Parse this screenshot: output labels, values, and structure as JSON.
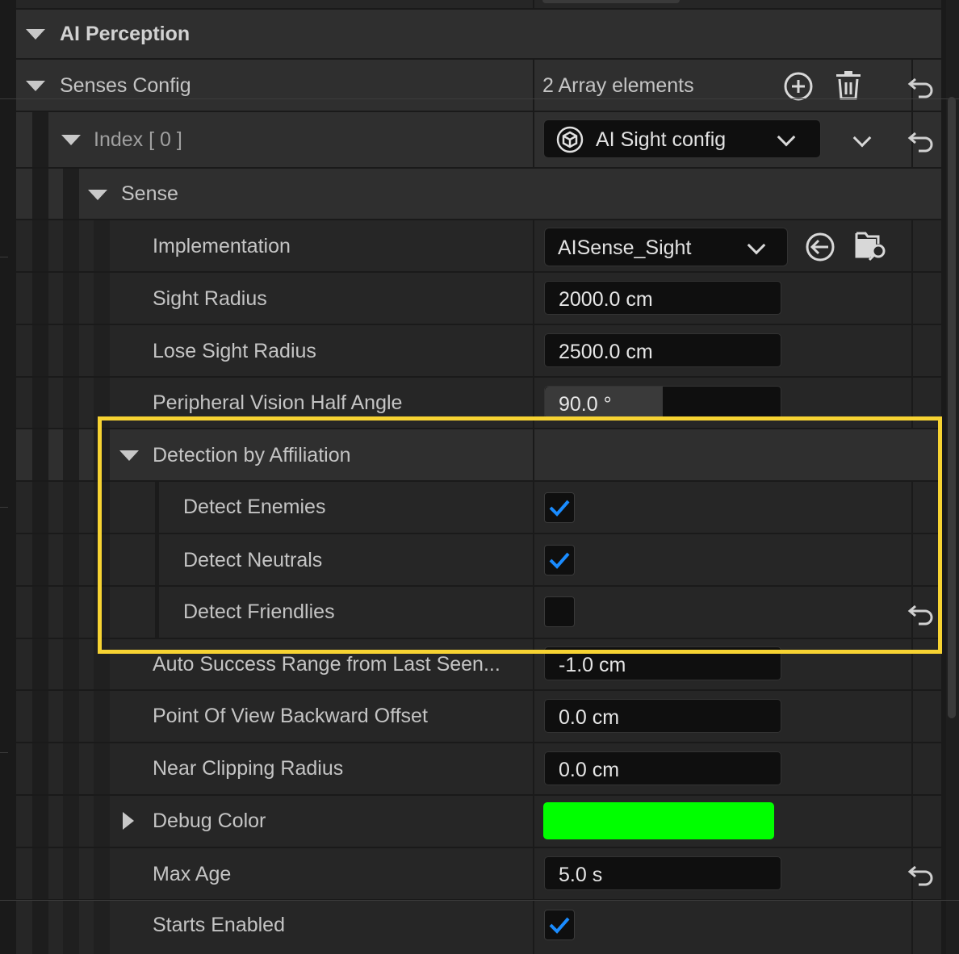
{
  "panel": {
    "category_title": "AI Perception",
    "senses_config": {
      "label": "Senses Config",
      "count_text": "2 Array elements",
      "add_icon": "plus-circle-icon",
      "delete_icon": "trash-icon",
      "reset_icon": "reset-arrow-icon"
    },
    "index_row": {
      "label": "Index [ 0 ]",
      "dropdown_value": "AI Sight config",
      "dropdown_icon": "cube-icon"
    },
    "sense_group": {
      "label": "Sense"
    },
    "properties": {
      "implementation": {
        "label": "Implementation",
        "value": "AISense_Sight"
      },
      "sight_radius": {
        "label": "Sight Radius",
        "value": "2000.0 cm"
      },
      "lose_sight_radius": {
        "label": "Lose Sight Radius",
        "value": "2500.0 cm"
      },
      "peripheral_vision": {
        "label": "Peripheral Vision Half Angle",
        "value": "90.0 °",
        "slider_fraction": 0.5
      },
      "detection_by_affiliation": {
        "label": "Detection by Affiliation"
      },
      "detect_enemies": {
        "label": "Detect Enemies",
        "checked": true
      },
      "detect_neutrals": {
        "label": "Detect Neutrals",
        "checked": true
      },
      "detect_friendlies": {
        "label": "Detect Friendlies",
        "checked": false
      },
      "auto_success_range": {
        "label": "Auto Success Range from Last Seen...",
        "value": "-1.0 cm"
      },
      "pov_backward_offset": {
        "label": "Point Of View Backward Offset",
        "value": "0.0 cm"
      },
      "near_clipping_radius": {
        "label": "Near Clipping Radius",
        "value": "0.0 cm"
      },
      "debug_color": {
        "label": "Debug Color",
        "color": "#00ff00"
      },
      "max_age": {
        "label": "Max Age",
        "value": "5.0 s"
      },
      "starts_enabled": {
        "label": "Starts Enabled",
        "checked": true
      }
    }
  },
  "colors": {
    "highlight": "#f7d332",
    "check": "#1a8cff",
    "debug_green": "#00ff00"
  }
}
